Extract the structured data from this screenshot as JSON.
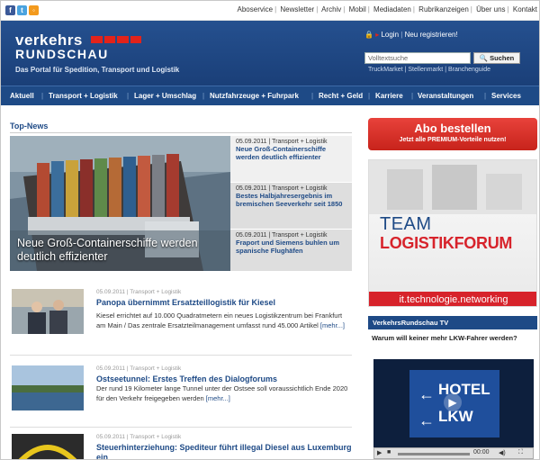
{
  "topbar": {
    "social": [
      {
        "icon": "facebook-icon",
        "glyph": "f",
        "color": "#3b5998"
      },
      {
        "icon": "twitter-icon",
        "glyph": "t",
        "color": "#4aa3df"
      },
      {
        "icon": "rss-icon",
        "glyph": "◦",
        "color": "#f39a1d"
      }
    ],
    "links": [
      "Aboservice",
      "Newsletter",
      "Archiv",
      "Mobil",
      "Mediadaten",
      "Rubrikanzeigen",
      "Über uns",
      "Kontakt"
    ]
  },
  "header": {
    "logo_line1": "verkehrs",
    "logo_line2": "RUNDSCHAU",
    "slogan": "Das Portal für Spedition, Transport und Logistik",
    "login": "Login",
    "register": "Neu registrieren!",
    "search_placeholder": "Volltextsuche",
    "search_button": "Suchen",
    "sublinks": "TruckMarket | Stellenmarkt | Branchenguide"
  },
  "nav": [
    "Aktuell",
    "Transport + Logistik",
    "Lager + Umschlag",
    "Nutzfahrzeuge + Fuhrpark",
    "Recht + Geld",
    "Karriere",
    "Veranstaltungen",
    "Services"
  ],
  "topnews": {
    "heading": "Top-News",
    "hero_caption": "Neue Groß-Containerschiffe werden deutlich effizienter",
    "teasers": [
      {
        "meta": "05.09.2011 | Transport + Logistik",
        "title": "Neue Groß-Containerschiffe werden deutlich effizienter"
      },
      {
        "meta": "05.09.2011 | Transport + Logistik",
        "title": "Bestes Halbjahresergebnis im bremischen Seeverkehr seit 1850"
      },
      {
        "meta": "05.09.2011 | Transport + Logistik",
        "title": "Fraport und Siemens buhlen um spanische Flughäfen"
      }
    ]
  },
  "articles": [
    {
      "meta": "05.09.2011 | Transport + Logistik",
      "title": "Panopa übernimmt Ersatzteillogistik für Kiesel",
      "text": "Kiesel errichtet auf 10.000 Quadratmetern ein neues Logistikzentrum bei Frankfurt am Main / Das zentrale Ersatzteilmanagement umfasst rund 45.000 Artikel",
      "more": "[mehr...]"
    },
    {
      "meta": "05.09.2011 | Transport + Logistik",
      "title": "Ostseetunnel: Erstes Treffen des Dialogforums",
      "text": "Der rund 19 Kilometer lange Tunnel unter der Ostsee soll voraussichtlich Ende 2020 für den Verkehr freigegeben werden",
      "more": "[mehr...]"
    },
    {
      "meta": "05.09.2011 | Transport + Logistik",
      "title": "Steuerhinterziehung: Spediteur führt illegal Diesel aus Luxemburg ein",
      "text": "",
      "more": ""
    }
  ],
  "sidebar": {
    "abo_title": "Abo bestellen",
    "abo_sub": "Jetzt alle PREMIUM-Vorteile nutzen!",
    "ad_team": "TEAM",
    "ad_logistik": "LOGISTIKFORUM",
    "ad_bar": "it.technologie.networking",
    "tv_heading": "VerkehrsRundschau TV",
    "tv_question": "Warum will keiner mehr LKW-Fahrer werden?",
    "video_sign1": "HOTEL",
    "video_sign2": "LKW",
    "time": "00:00"
  },
  "colors": {
    "brand_blue": "#1e4a86",
    "accent_red": "#d7232b"
  }
}
